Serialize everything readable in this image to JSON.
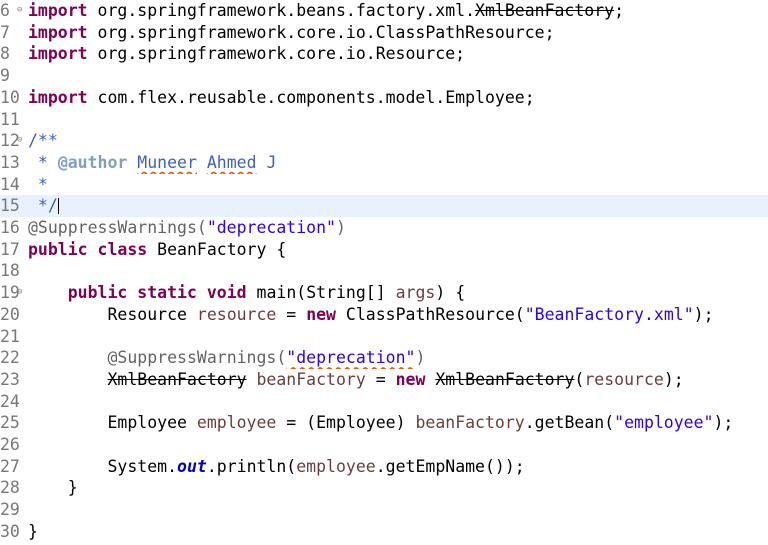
{
  "editor": {
    "lines": [
      {
        "num": "6",
        "fold": "⊖",
        "tokens": [
          {
            "t": "import",
            "c": "kw"
          },
          {
            "t": " org.springframework.beans.factory.xml."
          },
          {
            "t": "XmlBeanFactory",
            "c": "dep"
          },
          {
            "t": ";"
          }
        ]
      },
      {
        "num": "7",
        "tokens": [
          {
            "t": "import",
            "c": "kw"
          },
          {
            "t": " org.springframework.core.io.ClassPathResource;"
          }
        ]
      },
      {
        "num": "8",
        "tokens": [
          {
            "t": "import",
            "c": "kw"
          },
          {
            "t": " org.springframework.core.io.Resource;"
          }
        ]
      },
      {
        "num": "9",
        "tokens": []
      },
      {
        "num": "10",
        "tokens": [
          {
            "t": "import",
            "c": "kw"
          },
          {
            "t": " com.flex.reusable.components.model.Employee;"
          }
        ]
      },
      {
        "num": "11",
        "tokens": []
      },
      {
        "num": "12",
        "fold": "⊖",
        "tokens": [
          {
            "t": "/**",
            "c": "jd"
          }
        ]
      },
      {
        "num": "13",
        "tokens": [
          {
            "t": " * ",
            "c": "jd"
          },
          {
            "t": "@author",
            "c": "jdtag"
          },
          {
            "t": " ",
            "c": "jd"
          },
          {
            "t": "Muneer",
            "c": "jd squig"
          },
          {
            "t": " ",
            "c": "jd"
          },
          {
            "t": "Ahmed",
            "c": "jd squig"
          },
          {
            "t": " J",
            "c": "jd"
          }
        ]
      },
      {
        "num": "14",
        "tokens": [
          {
            "t": " *",
            "c": "jd"
          }
        ]
      },
      {
        "num": "15",
        "current": true,
        "caret": true,
        "tokens": [
          {
            "t": " */",
            "c": "jd"
          }
        ]
      },
      {
        "num": "16",
        "tokens": [
          {
            "t": "@SuppressWarnings(",
            "c": "ann"
          },
          {
            "t": "\"deprecation\"",
            "c": "str"
          },
          {
            "t": ")",
            "c": "ann"
          }
        ]
      },
      {
        "num": "17",
        "tokens": [
          {
            "t": "public",
            "c": "kw"
          },
          {
            "t": " "
          },
          {
            "t": "class",
            "c": "kw"
          },
          {
            "t": " BeanFactory {"
          }
        ]
      },
      {
        "num": "18",
        "tokens": []
      },
      {
        "num": "19",
        "fold": "⊖",
        "tokens": [
          {
            "t": "    "
          },
          {
            "t": "public",
            "c": "kw"
          },
          {
            "t": " "
          },
          {
            "t": "static",
            "c": "kw"
          },
          {
            "t": " "
          },
          {
            "t": "void",
            "c": "kw"
          },
          {
            "t": " main(String[] "
          },
          {
            "t": "args",
            "c": "var"
          },
          {
            "t": ") {"
          }
        ]
      },
      {
        "num": "20",
        "tokens": [
          {
            "t": "        Resource "
          },
          {
            "t": "resource",
            "c": "var"
          },
          {
            "t": " = "
          },
          {
            "t": "new",
            "c": "kw"
          },
          {
            "t": " ClassPathResource("
          },
          {
            "t": "\"BeanFactory.xml\"",
            "c": "str"
          },
          {
            "t": ");"
          }
        ]
      },
      {
        "num": "21",
        "tokens": []
      },
      {
        "num": "22",
        "tokens": [
          {
            "t": "        "
          },
          {
            "t": "@SuppressWarnings(",
            "c": "ann"
          },
          {
            "t": "\"deprecation\"",
            "c": "str squig"
          },
          {
            "t": ")",
            "c": "ann"
          }
        ]
      },
      {
        "num": "23",
        "tokens": [
          {
            "t": "        "
          },
          {
            "t": "XmlBeanFactory",
            "c": "dep"
          },
          {
            "t": " "
          },
          {
            "t": "beanFactory",
            "c": "var"
          },
          {
            "t": " = "
          },
          {
            "t": "new",
            "c": "kw"
          },
          {
            "t": " "
          },
          {
            "t": "XmlBeanFactory",
            "c": "dep"
          },
          {
            "t": "("
          },
          {
            "t": "resource",
            "c": "var"
          },
          {
            "t": ");"
          }
        ]
      },
      {
        "num": "24",
        "tokens": []
      },
      {
        "num": "25",
        "tokens": [
          {
            "t": "        Employee "
          },
          {
            "t": "employee",
            "c": "var"
          },
          {
            "t": " = (Employee) "
          },
          {
            "t": "beanFactory",
            "c": "var"
          },
          {
            "t": ".getBean("
          },
          {
            "t": "\"employee\"",
            "c": "str"
          },
          {
            "t": ");"
          }
        ]
      },
      {
        "num": "26",
        "tokens": []
      },
      {
        "num": "27",
        "tokens": [
          {
            "t": "        System."
          },
          {
            "t": "out",
            "c": "static-field"
          },
          {
            "t": ".println("
          },
          {
            "t": "employee",
            "c": "var"
          },
          {
            "t": ".getEmpName());"
          }
        ]
      },
      {
        "num": "28",
        "tokens": [
          {
            "t": "    }"
          }
        ]
      },
      {
        "num": "29",
        "tokens": []
      },
      {
        "num": "30",
        "tokens": [
          {
            "t": "}"
          }
        ]
      }
    ]
  }
}
